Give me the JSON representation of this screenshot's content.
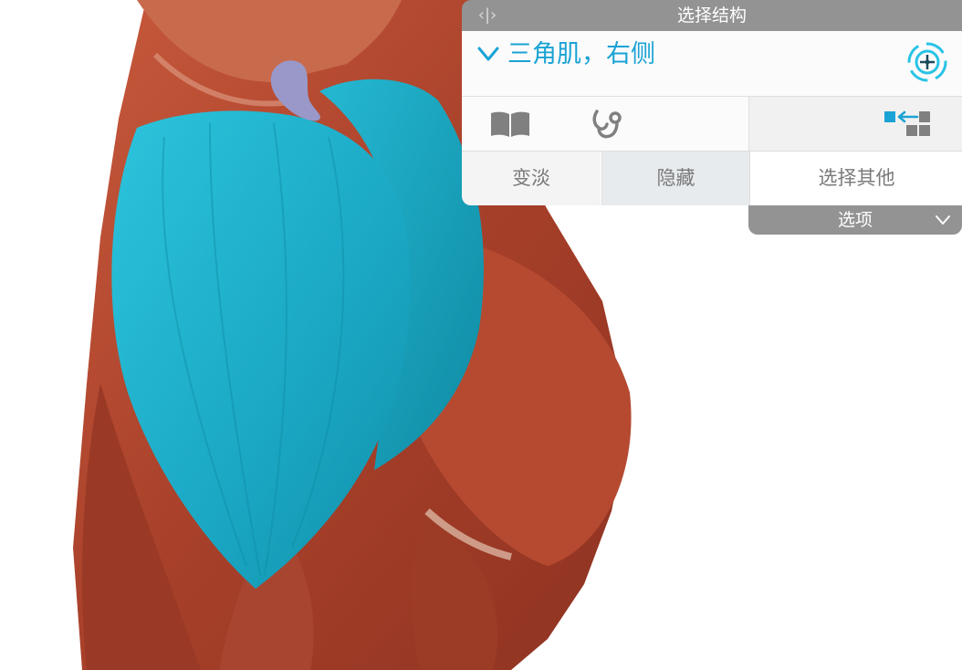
{
  "panel": {
    "collapse_toggle_label": "‹|›",
    "title": "选择结构",
    "structure_name": "三角肌，右侧",
    "actions": {
      "fade": "变淡",
      "hide": "隐藏",
      "select_other": "选择其他"
    },
    "options_label": "选项"
  },
  "icons": {
    "expand": "chevron-down-icon",
    "target": "target-icon",
    "book": "book-icon",
    "stethoscope": "stethoscope-icon",
    "isolate": "isolate-icon",
    "options": "chevron-down-icon"
  },
  "colors": {
    "accent": "#1aa3d4",
    "selected_muscle": "#1ba7c4",
    "muscle": "#b2472f",
    "bone_marker": "#9a98c8",
    "header": "#939393"
  }
}
